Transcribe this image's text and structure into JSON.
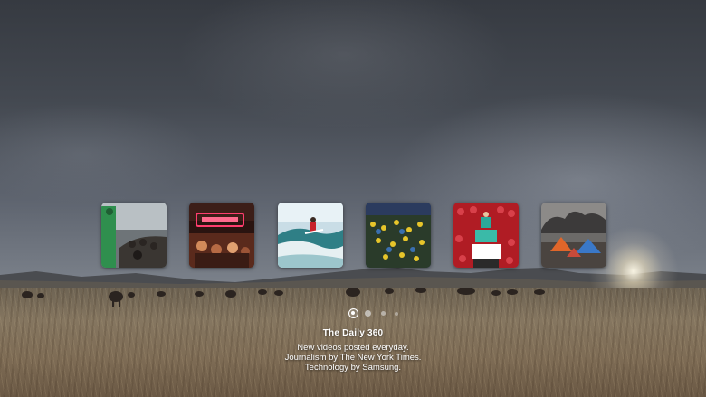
{
  "channel": {
    "title": "The Daily 360",
    "description_lines": [
      "New videos posted everyday.",
      "Journalism by The New York Times.",
      "Technology by Samsung."
    ]
  },
  "carousel": {
    "items": [
      {
        "subject": "boat-scene",
        "accent": "#2f8f4e"
      },
      {
        "subject": "neon-street-scene",
        "accent": "#ff3d6e"
      },
      {
        "subject": "surfer-wave-scene",
        "accent": "#e8f2f6"
      },
      {
        "subject": "stadium-crowd-scene",
        "accent": "#e7c52a"
      },
      {
        "subject": "human-tower-scene",
        "accent": "#c8202a"
      },
      {
        "subject": "smoke-camp-scene",
        "accent": "#3a78c8"
      }
    ],
    "page_count": 4,
    "active_page": 1
  },
  "colors": {
    "text": "#ffffff",
    "sky_top": "#363a41",
    "ground": "#857660"
  }
}
